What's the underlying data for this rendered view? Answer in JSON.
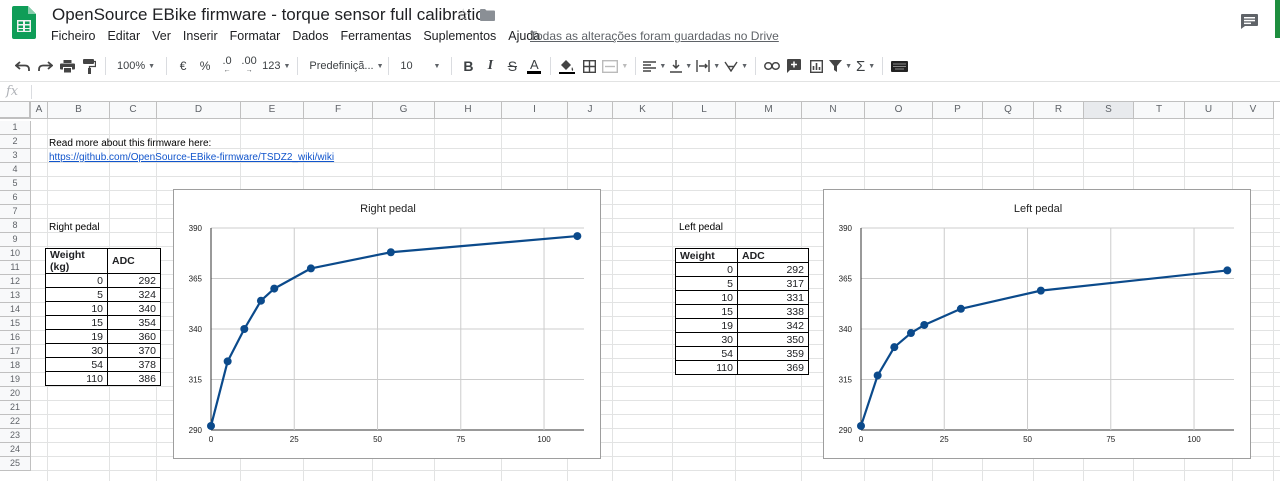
{
  "doc": {
    "title": "OpenSource EBike firmware - torque sensor full calibration",
    "save_status": "Todas as alterações foram guardadas no Drive"
  },
  "menu": [
    "Ficheiro",
    "Editar",
    "Ver",
    "Inserir",
    "Formatar",
    "Dados",
    "Ferramentas",
    "Suplementos",
    "Ajuda"
  ],
  "toolbar": {
    "zoom": "100%",
    "currency": "€",
    "percent": "%",
    "dec_less": ".0",
    "dec_more": ".00",
    "more_formats": "123",
    "font": "Predefiniçã...",
    "font_size": "10"
  },
  "formula_bar": {
    "fx": "fx",
    "value": ""
  },
  "columns": [
    "A",
    "B",
    "C",
    "D",
    "E",
    "F",
    "G",
    "H",
    "I",
    "J",
    "K",
    "L",
    "M",
    "N",
    "O",
    "P",
    "Q",
    "R",
    "S",
    "T",
    "U",
    "V"
  ],
  "selected_column": "S",
  "rows": [
    "1",
    "2",
    "3",
    "4",
    "5",
    "6",
    "7",
    "8",
    "9",
    "10",
    "11",
    "12",
    "13",
    "14",
    "15",
    "16",
    "17",
    "18",
    "19",
    "20",
    "21",
    "22",
    "23",
    "24",
    "25"
  ],
  "sheet": {
    "intro": "Read more about this firmware here:",
    "link": "https://github.com/OpenSource-EBike-firmware/TSDZ2_wiki/wiki",
    "right_label": "Right pedal",
    "left_label": "Left pedal"
  },
  "right_table": {
    "headers": [
      "Weight (kg)",
      "ADC"
    ],
    "rows": [
      [
        "0",
        "292"
      ],
      [
        "5",
        "324"
      ],
      [
        "10",
        "340"
      ],
      [
        "15",
        "354"
      ],
      [
        "19",
        "360"
      ],
      [
        "30",
        "370"
      ],
      [
        "54",
        "378"
      ],
      [
        "110",
        "386"
      ]
    ]
  },
  "left_table": {
    "headers": [
      "Weight",
      "ADC"
    ],
    "rows": [
      [
        "0",
        "292"
      ],
      [
        "5",
        "317"
      ],
      [
        "10",
        "331"
      ],
      [
        "15",
        "338"
      ],
      [
        "19",
        "342"
      ],
      [
        "30",
        "350"
      ],
      [
        "54",
        "359"
      ],
      [
        "110",
        "369"
      ]
    ]
  },
  "chart_data": [
    {
      "type": "line",
      "title": "Right pedal",
      "x": [
        0,
        5,
        10,
        15,
        19,
        30,
        54,
        110
      ],
      "y": [
        292,
        324,
        340,
        354,
        360,
        370,
        378,
        386
      ],
      "xlim": [
        0,
        112
      ],
      "ylim": [
        290,
        390
      ],
      "xticks": [
        "0",
        "25",
        "50",
        "75",
        "100"
      ],
      "yticks": [
        "290",
        "315",
        "340",
        "365",
        "390"
      ],
      "color": "#0b4a8b",
      "grid": true
    },
    {
      "type": "line",
      "title": "Left pedal",
      "x": [
        0,
        5,
        10,
        15,
        19,
        30,
        54,
        110
      ],
      "y": [
        292,
        317,
        331,
        338,
        342,
        350,
        359,
        369
      ],
      "xlim": [
        0,
        112
      ],
      "ylim": [
        290,
        390
      ],
      "xticks": [
        "0",
        "25",
        "50",
        "75",
        "100"
      ],
      "yticks": [
        "290",
        "315",
        "340",
        "365",
        "390"
      ],
      "color": "#0b4a8b",
      "grid": true
    }
  ]
}
